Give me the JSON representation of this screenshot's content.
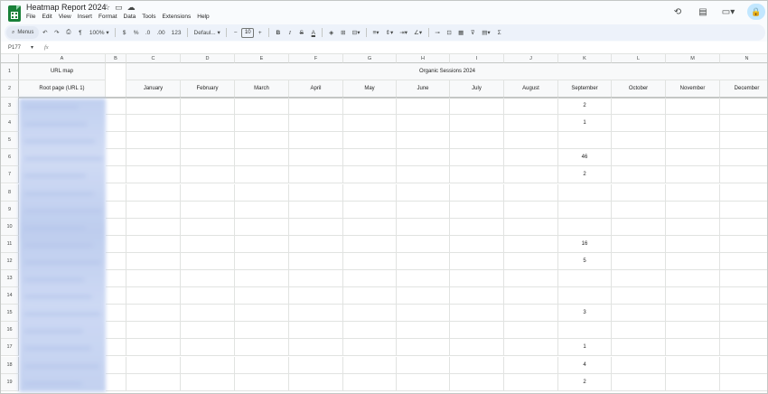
{
  "document": {
    "title": "Heatmap Report 2024"
  },
  "menubar": [
    "File",
    "Edit",
    "View",
    "Insert",
    "Format",
    "Data",
    "Tools",
    "Extensions",
    "Help"
  ],
  "toolbar": {
    "search_label": "Menus",
    "zoom": "100%",
    "currency": "$",
    "percent": "%",
    "decimal_decrease": ".0",
    "decimal_increase": ".00",
    "number_format": "123",
    "font": "Defaul...",
    "font_size": "10"
  },
  "formula_bar": {
    "cell_ref": "P177",
    "fx": "fx"
  },
  "grid": {
    "columns": [
      "A",
      "B",
      "C",
      "D",
      "E",
      "F",
      "G",
      "H",
      "I",
      "J",
      "K",
      "L",
      "M",
      "N"
    ],
    "row_numbers": [
      "1",
      "2",
      "3",
      "4",
      "5",
      "6",
      "7",
      "8",
      "9",
      "10",
      "11",
      "12",
      "13",
      "14",
      "15",
      "16",
      "17",
      "18",
      "19"
    ],
    "a1_header": "URL map",
    "a2_header": "Root page (URL 1)",
    "group_header": "Organic Sessions 2024",
    "months": [
      "January",
      "February",
      "March",
      "April",
      "May",
      "June",
      "July",
      "August",
      "September",
      "October",
      "November",
      "December"
    ],
    "september_values": [
      "2",
      "1",
      "",
      "46",
      "2",
      "",
      "",
      "",
      "16",
      "5",
      "",
      "",
      "3",
      "",
      "1",
      "4",
      "2"
    ]
  },
  "colors": {
    "accent": "#0b57d0",
    "logo": "#188038",
    "toolbar_bg": "#edf2fa"
  }
}
